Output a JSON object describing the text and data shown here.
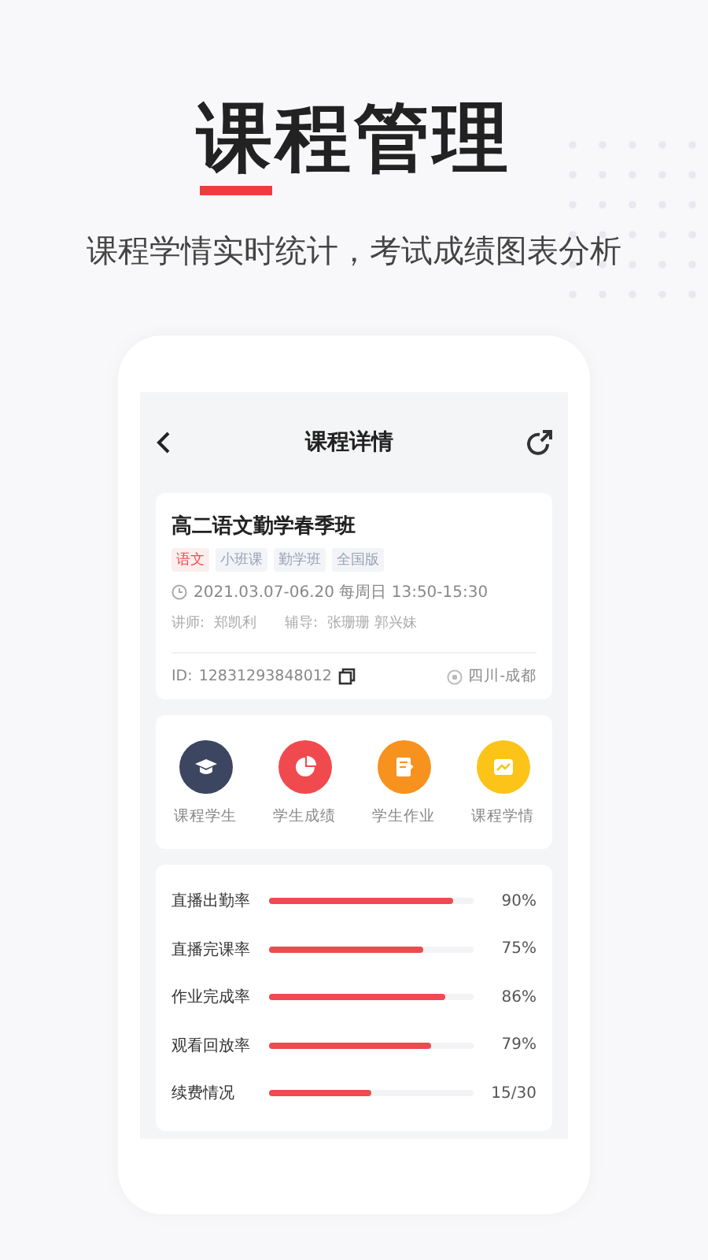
{
  "headline": "课程管理",
  "subtitle": "课程学情实时统计，考试成绩图表分析",
  "screen": {
    "title": "课程详情",
    "course": {
      "name": "高二语文勤学春季班",
      "tags": [
        {
          "label": "语文",
          "kind": "subject"
        },
        {
          "label": "小班课",
          "kind": "plain"
        },
        {
          "label": "勤学班",
          "kind": "plain"
        },
        {
          "label": "全国版",
          "kind": "plain"
        }
      ],
      "schedule": "2021.03.07-06.20 每周日 13:50-15:30",
      "teacher_label": "讲师:",
      "teacher": "郑凯利",
      "tutor_label": "辅导:",
      "tutors": "张珊珊  郭兴妹",
      "id_label": "ID:",
      "id": "12831293848012",
      "location": "四川-成都"
    },
    "shortcuts": [
      {
        "label": "课程学生",
        "color": "#3d4660",
        "kind": "cap"
      },
      {
        "label": "学生成绩",
        "color": "#f04a4f",
        "kind": "pie"
      },
      {
        "label": "学生作业",
        "color": "#f7921e",
        "kind": "note"
      },
      {
        "label": "课程学情",
        "color": "#fcc419",
        "kind": "trend"
      }
    ],
    "stats": [
      {
        "label": "直播出勤率",
        "level": 0.9,
        "reading": "90%"
      },
      {
        "label": "直播完课率",
        "level": 0.75,
        "reading": "75%"
      },
      {
        "label": "作业完成率",
        "level": 0.86,
        "reading": "86%"
      },
      {
        "label": "观看回放率",
        "level": 0.79,
        "reading": "79%"
      },
      {
        "label": "续费情况",
        "level": 0.5,
        "reading": "15/30"
      }
    ]
  }
}
